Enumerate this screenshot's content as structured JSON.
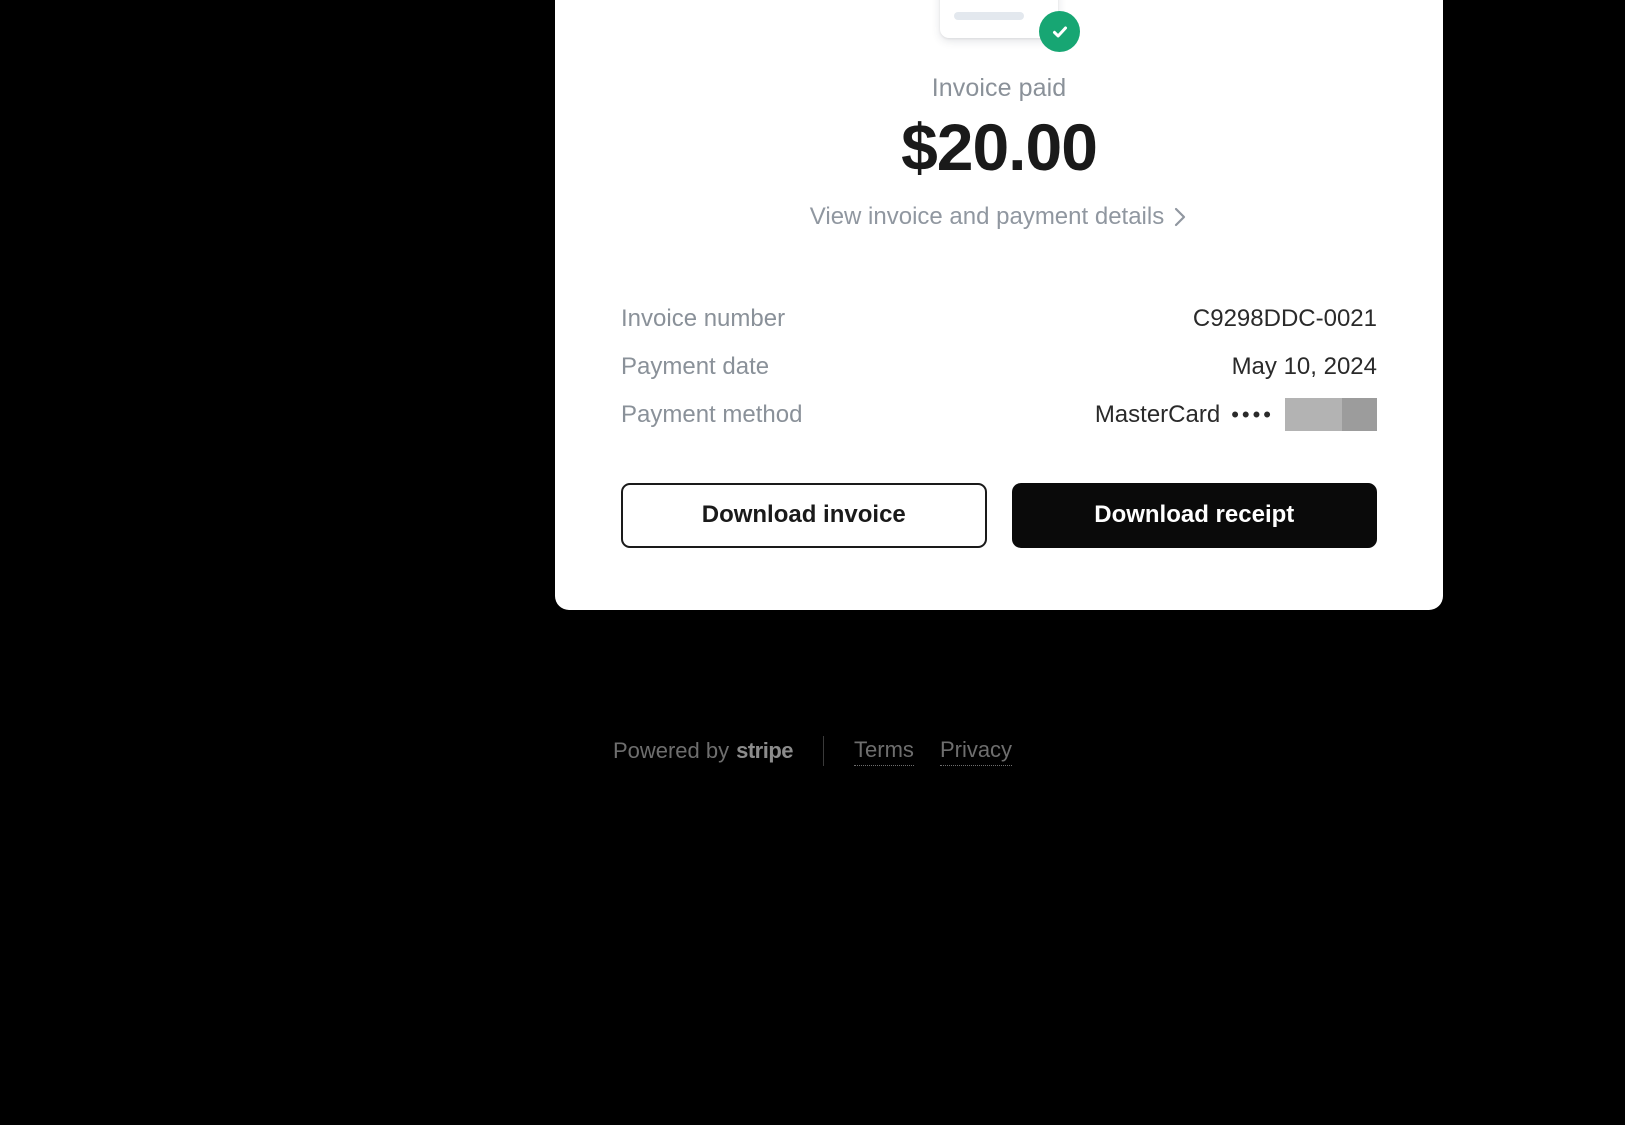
{
  "page": {
    "background_color": "#000000",
    "card_background": "#ffffff"
  },
  "receipt": {
    "icon": {
      "document_icon_name": "invoice-document-icon",
      "badge_icon_name": "green-check-badge-icon",
      "badge_color": "#17a673"
    },
    "status_text": "Invoice paid",
    "amount": "$20.00",
    "details_link_label": "View invoice and payment details",
    "details_link_chevron": "chevron-right-icon",
    "rows": [
      {
        "label": "Invoice number",
        "value": "C9298DDC-0021",
        "redacted": false
      },
      {
        "label": "Payment date",
        "value": "May 10, 2024",
        "redacted": false
      },
      {
        "label": "Payment method",
        "value": "MasterCard",
        "dots": "••••",
        "redacted": true
      }
    ],
    "buttons": {
      "secondary_label": "Download invoice",
      "primary_label": "Download receipt"
    }
  },
  "footer": {
    "powered_by_prefix": "Powered by",
    "brand": "stripe",
    "links": [
      {
        "label": "Terms"
      },
      {
        "label": "Privacy"
      }
    ]
  }
}
